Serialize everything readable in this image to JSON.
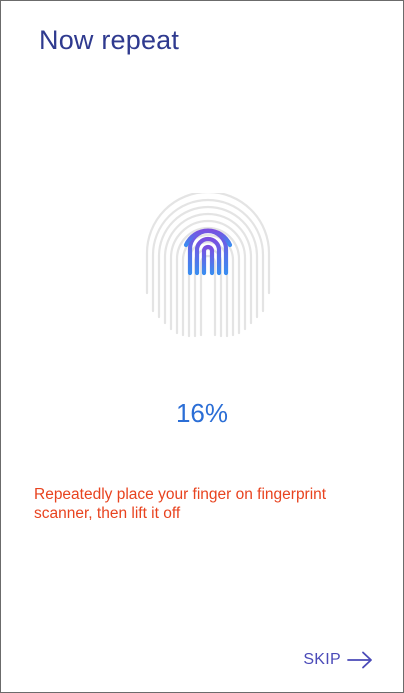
{
  "colors": {
    "title": "#2f3a8f",
    "accent": "#2b6ed6",
    "warning": "#e8431f",
    "skip": "#4a4ab8",
    "fingerprint_faint": "#e4e4e4",
    "fingerprint_top": "#7b4fe0",
    "fingerprint_bottom": "#3b8cf0"
  },
  "screen": {
    "title": "Now repeat",
    "fingerprint_icon": "fingerprint-icon",
    "progress_percent": 16,
    "progress_label": "16%",
    "instruction": "Repeatedly place your finger on fingerprint scanner, then lift it off",
    "skip_label": "SKIP",
    "skip_icon": "arrow-right-icon"
  }
}
